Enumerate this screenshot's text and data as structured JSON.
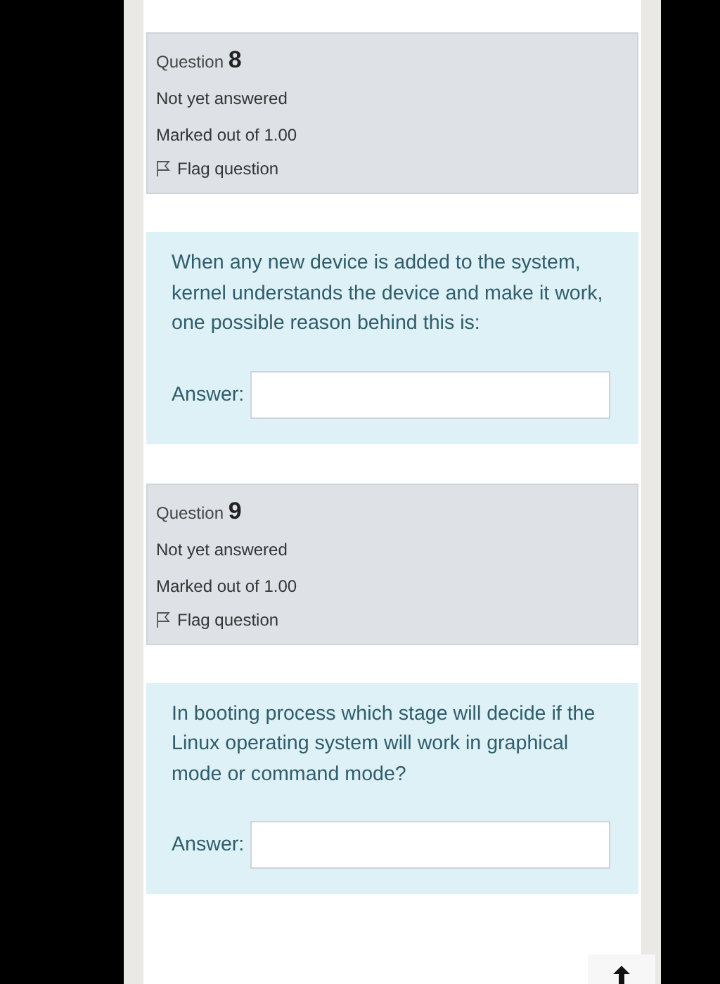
{
  "questions": [
    {
      "label": "Question",
      "number": "8",
      "status": "Not yet answered",
      "marks": "Marked out of 1.00",
      "flag": "Flag question",
      "flagged": false,
      "text": "When any new device is added to the system, kernel understands the device and make it work, one possible reason behind this is:",
      "answer_label": "Answer:"
    },
    {
      "label": "Question",
      "number": "9",
      "status": "Not yet answered",
      "marks": "Marked out of 1.00",
      "flag": "Flag question",
      "flagged": false,
      "text": "In booting process which stage will decide if the Linux operating system will work in graphical mode or command mode?",
      "answer_label": "Answer:"
    }
  ]
}
